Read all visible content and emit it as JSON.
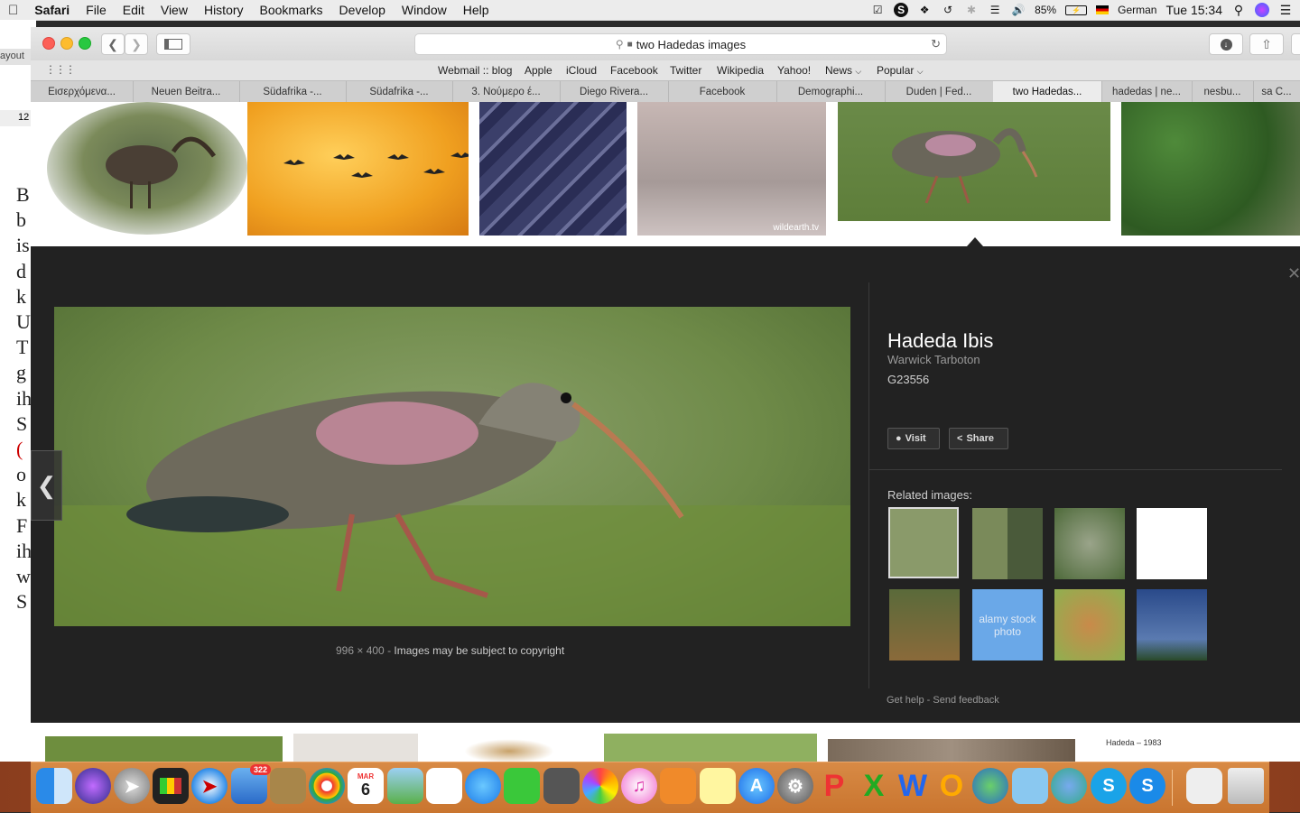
{
  "menubar": {
    "app": "Safari",
    "items": [
      "File",
      "Edit",
      "View",
      "History",
      "Bookmarks",
      "Develop",
      "Window",
      "Help"
    ],
    "battery": "85%",
    "input_language": "German",
    "clock": "Tue 15:34"
  },
  "background_window": {
    "label": "ayout",
    "zoom": "12",
    "letters": [
      "B",
      "b",
      "is",
      "d",
      "k",
      "U",
      "T",
      "g",
      "ih",
      "S",
      "(",
      "o",
      "k",
      "F",
      "ih",
      "w",
      "S"
    ]
  },
  "browser": {
    "url": "two Hadedas images",
    "favorites": [
      "Webmail :: blog",
      "Apple",
      "iCloud",
      "Facebook",
      "Twitter",
      "Wikipedia",
      "Yahoo!",
      "News",
      "Popular"
    ],
    "tabs": [
      "Εισερχόμενα...",
      "Neuen Beitra...",
      "Südafrika -...",
      "Südafrika -...",
      "3. Νούμερο έ...",
      "Diego Rivera...",
      "Facebook",
      "Demographi...",
      "Duden | Fed...",
      "two Hadedas...",
      "hadedas | ne...",
      "nesbu...",
      "sa C..."
    ],
    "active_tab": "two Hadedas..."
  },
  "viewer": {
    "title": "Hadeda Ibis",
    "source": "Warwick Tarboton",
    "id": "G23556",
    "visit_label": "Visit",
    "share_label": "Share",
    "dimensions": "996 × 400",
    "separator": "-",
    "copyright": "Images may be subject to copyright",
    "related_label": "Related images:",
    "related_watermark": "alamy stock photo",
    "footer_help": "Get help",
    "footer_feedback": "Send feedback"
  },
  "bottom_caption": "Hadeda – 1983",
  "thumb_watermarks": [
    "wildearth.tv"
  ],
  "dock": {
    "mail_badge": "322",
    "calendar_month": "MAR",
    "calendar_day": "6"
  }
}
